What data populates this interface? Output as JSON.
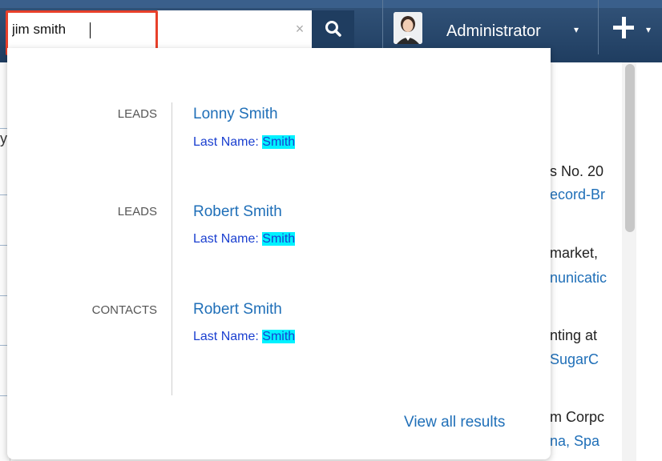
{
  "search": {
    "value": "jim smith",
    "clear_icon": "close-icon",
    "button_icon": "search-icon"
  },
  "user": {
    "name": "Administrator",
    "caret": "▾"
  },
  "quick_create": {
    "icon": "plus-icon",
    "caret": "▾"
  },
  "results": [
    {
      "module": "LEADS",
      "name": "Lonny Smith",
      "field_label": "Last Name:",
      "match": "Smith"
    },
    {
      "module": "LEADS",
      "name": "Robert Smith",
      "field_label": "Last Name:",
      "match": "Smith"
    },
    {
      "module": "CONTACTS",
      "name": "Robert Smith",
      "field_label": "Last Name:",
      "match": "Smith"
    }
  ],
  "view_all": "View all results",
  "background": {
    "left_glyph": "y",
    "lines": [
      {
        "text": "s No. 20",
        "link": false
      },
      {
        "text": "ecord-Br",
        "link": true
      },
      {
        "text": "market,",
        "link": false
      },
      {
        "text": "nunicatic",
        "link": true
      },
      {
        "text": "nting at",
        "link": false
      },
      {
        "text": "SugarC",
        "link": true
      },
      {
        "text": "m Corpc",
        "link": false
      },
      {
        "text": "na, Spa",
        "link": true
      }
    ]
  },
  "colors": {
    "header": "#1f3d60",
    "highlight_border": "#e8402a",
    "link": "#1f6fb8",
    "match_highlight": "#00f2ff"
  }
}
